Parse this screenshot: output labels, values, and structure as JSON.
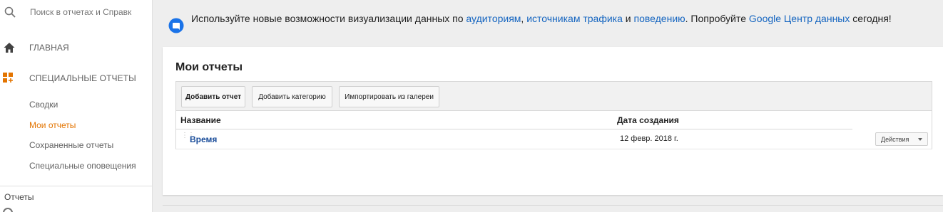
{
  "sidebar": {
    "search": {
      "placeholder": "Поиск в отчетах и Справк"
    },
    "home_label": "ГЛАВНАЯ",
    "custom_reports_label": "СПЕЦИАЛЬНЫЕ ОТЧЕТЫ",
    "sub_items": [
      {
        "label": "Сводки"
      },
      {
        "label": "Мои отчеты"
      },
      {
        "label": "Сохраненные отчеты"
      },
      {
        "label": "Специальные оповещения"
      }
    ],
    "reports_label": "Отчеты"
  },
  "notice": {
    "part1": "Используйте новые возможности визуализации данных по ",
    "link_audience": "аудиториям",
    "sep1": ", ",
    "link_traffic": "источникам трафика",
    "sep2": " и ",
    "link_behavior": "поведению",
    "part2": ". Попробуйте ",
    "link_datastudio": "Google Центр данных",
    "part3": " сегодня!"
  },
  "main": {
    "title": "Мои отчеты",
    "toolbar": {
      "add_report": "Добавить отчет",
      "add_category": "Добавить категорию",
      "import_gallery": "Импортировать из галереи"
    },
    "table": {
      "col_name": "Название",
      "col_date": "Дата создания",
      "rows": [
        {
          "name": "Время",
          "date": "12 февр. 2018 г.",
          "actions": "Действия"
        }
      ]
    }
  },
  "colors": {
    "accent_active": "#e37400",
    "link": "#1565c0",
    "icon_orange": "#e37400"
  },
  "icons": {
    "search": "search-icon",
    "home": "home-icon",
    "custom_reports": "custom-reports-icon",
    "notice": "notice-icon"
  }
}
